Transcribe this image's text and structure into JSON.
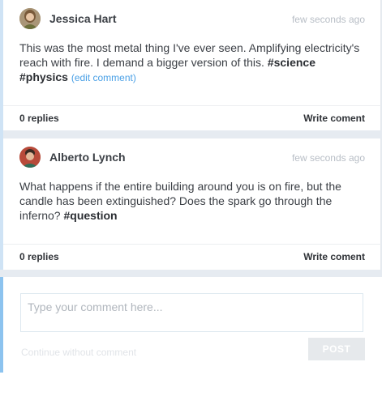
{
  "posts": [
    {
      "author": "Jessica Hart",
      "time": "few seconds ago",
      "text": "This was the most metal thing I've ever seen. Amplifying electricity's reach with fire. I demand a bigger version of this.",
      "tags": [
        "#science",
        "#physics"
      ],
      "edit_label": "(edit comment)",
      "replies": "0 replies",
      "write_label": "Write coment"
    },
    {
      "author": "Alberto Lynch",
      "time": "few seconds ago",
      "text": "What happens if the entire building around you is on fire, but the candle has been extinguished? Does the spark go through the inferno?",
      "tags": [
        "#question"
      ],
      "replies": "0 replies",
      "write_label": "Write coment"
    }
  ],
  "composer": {
    "placeholder": "Type your comment here...",
    "continue_label": "Continue without comment",
    "post_label": "POST"
  },
  "colors": {
    "accent": "#4aa0e6",
    "page_bg": "#e6ebf1"
  }
}
